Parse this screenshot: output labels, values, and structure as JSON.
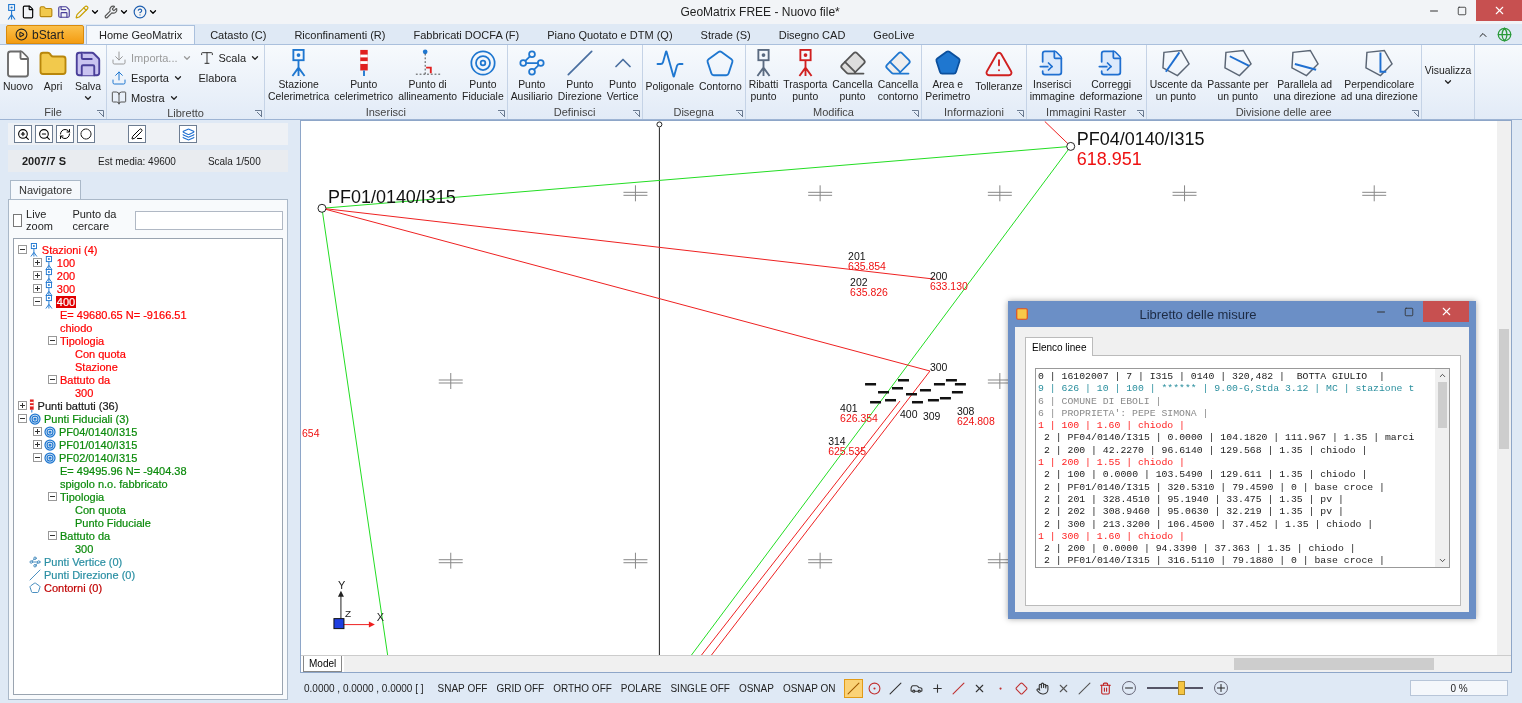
{
  "window": {
    "title": "GeoMatrix FREE - Nuovo file*"
  },
  "start_button": "bStart",
  "tabs": [
    {
      "label": "Home GeoMatrix",
      "selected": true
    },
    {
      "label": "Catasto (C)",
      "selected": false
    },
    {
      "label": "Riconfinamenti (R)",
      "selected": false
    },
    {
      "label": "Fabbricati DOCFA (F)",
      "selected": false
    },
    {
      "label": "Piano Quotato e DTM (Q)",
      "selected": false
    },
    {
      "label": "Strade (S)",
      "selected": false
    },
    {
      "label": "Disegno CAD",
      "selected": false
    },
    {
      "label": "GeoLive",
      "selected": false
    }
  ],
  "ribbon": {
    "groups": [
      {
        "title": "File",
        "buttons": [
          {
            "label": "Nuovo",
            "dropdown": false
          },
          {
            "label": "Apri",
            "dropdown": false
          },
          {
            "label": "Salva",
            "dropdown": true
          }
        ]
      },
      {
        "title": "Libretto",
        "small_buttons": [
          {
            "label": "Importa...",
            "disabled": true,
            "dropdown": true
          },
          {
            "label": "Esporta",
            "disabled": false,
            "dropdown": true
          },
          {
            "label": "Mostra",
            "disabled": false,
            "dropdown": true
          },
          {
            "label": "Scala",
            "disabled": false,
            "dropdown": true
          },
          {
            "label": "Elabora",
            "disabled": false,
            "dropdown": false
          }
        ]
      },
      {
        "title": "Inserisci",
        "buttons": [
          {
            "label": "Stazione\nCelerimetrica",
            "dropdown": false
          },
          {
            "label": "Punto\ncelerimetrico",
            "dropdown": false
          },
          {
            "label": "Punto di\nallineamento",
            "dropdown": false
          },
          {
            "label": "Punto\nFiduciale",
            "dropdown": false
          }
        ]
      },
      {
        "title": "Definisci",
        "buttons": [
          {
            "label": "Punto\nAusiliario",
            "dropdown": false
          },
          {
            "label": "Punto\nDirezione",
            "dropdown": false
          },
          {
            "label": "Punto\nVertice",
            "dropdown": false
          }
        ]
      },
      {
        "title": "Disegna",
        "buttons": [
          {
            "label": "Poligonale",
            "dropdown": false
          },
          {
            "label": "Contorno",
            "dropdown": false
          }
        ]
      },
      {
        "title": "Modifica",
        "buttons": [
          {
            "label": "Ribatti\npunto",
            "dropdown": false
          },
          {
            "label": "Trasporta\npunto",
            "dropdown": false
          },
          {
            "label": "Cancella\npunto",
            "dropdown": false
          },
          {
            "label": "Cancella\ncontorno",
            "dropdown": false
          }
        ]
      },
      {
        "title": "Informazioni",
        "buttons": [
          {
            "label": "Area e\nPerimetro",
            "dropdown": false
          },
          {
            "label": "Tolleranze",
            "dropdown": false
          }
        ]
      },
      {
        "title": "Immagini Raster",
        "buttons": [
          {
            "label": "Inserisci\nimmagine",
            "dropdown": false
          },
          {
            "label": "Correggi\ndeformazione",
            "dropdown": false
          }
        ]
      },
      {
        "title": "Divisione delle aree",
        "buttons": [
          {
            "label": "Uscente da\nun punto",
            "dropdown": false
          },
          {
            "label": "Passante per\nun punto",
            "dropdown": false
          },
          {
            "label": "Parallela ad\nuna direzione",
            "dropdown": false
          },
          {
            "label": "Perpendicolare\nad una direzione",
            "dropdown": false
          }
        ]
      },
      {
        "buttons": [
          {
            "label": "Visualizza",
            "dropdown": true
          }
        ]
      }
    ]
  },
  "left_panel": {
    "info": {
      "code": "2007/7 S",
      "est_media": "Est media: 49600",
      "scale": "Scala 1/500"
    },
    "tab": "Navigatore",
    "live_zoom": {
      "label": "Live zoom",
      "checked": false
    },
    "search": {
      "label": "Punto da cercare"
    },
    "tree": [
      {
        "label": "Stazioni (4)",
        "color": "#ff0000",
        "selected": false,
        "expanded": true,
        "children": [
          {
            "label": "100",
            "selected": false,
            "expanded": false
          },
          {
            "label": "200",
            "selected": false,
            "expanded": false
          },
          {
            "label": "300",
            "selected": false,
            "expanded": false
          },
          {
            "label": "400",
            "selected": true,
            "expanded": true,
            "children": [
              {
                "label": "E= 49680.65 N= -9166.51",
                "selected": false
              },
              {
                "label": "chiodo",
                "selected": false
              },
              {
                "label": "Tipologia",
                "selected": false,
                "expanded": true,
                "children": [
                  {
                    "label": "Con quota",
                    "selected": false
                  },
                  {
                    "label": "Stazione",
                    "selected": false
                  }
                ]
              },
              {
                "label": "Battuto da",
                "selected": false,
                "expanded": true,
                "children": [
                  {
                    "label": "300",
                    "selected": false
                  }
                ]
              }
            ]
          }
        ]
      },
      {
        "label": "Punti battuti (36)",
        "color": "#1a1a1a",
        "selected": false,
        "expanded": false
      },
      {
        "label": "Punti Fiduciali (3)",
        "color": "#0a8a0a",
        "selected": false,
        "expanded": true,
        "children": [
          {
            "label": "PF04/0140/I315",
            "selected": false,
            "expanded": false
          },
          {
            "label": "PF01/0140/I315",
            "selected": false,
            "expanded": false
          },
          {
            "label": "PF02/0140/I315",
            "selected": false,
            "expanded": true,
            "children": [
              {
                "label": "E= 49495.96 N= -9404.38",
                "selected": false
              },
              {
                "label": "spigolo n.o. fabbricato",
                "selected": false
              },
              {
                "label": "Tipologia",
                "selected": false,
                "expanded": true,
                "children": [
                  {
                    "label": "Con quota",
                    "selected": false
                  },
                  {
                    "label": "Punto Fiduciale",
                    "selected": false
                  }
                ]
              },
              {
                "label": "Battuto da",
                "selected": false,
                "expanded": true,
                "children": [
                  {
                    "label": "300",
                    "selected": false
                  }
                ]
              }
            ]
          }
        ]
      },
      {
        "label": "Punti Vertice (0)",
        "color": "#2a8fa3",
        "selected": false
      },
      {
        "label": "Punti Direzione (0)",
        "color": "#2a8fa3",
        "selected": false
      },
      {
        "label": "Contorni (0)",
        "color": "#c00000",
        "selected": false
      }
    ]
  },
  "canvas": {
    "fiducials": [
      {
        "id": "PF01/0140/I315"
      },
      {
        "id": "PF04/0140/I315",
        "elevation": "618.951"
      }
    ],
    "points": [
      {
        "id": "201",
        "elevation": "635.854"
      },
      {
        "id": "202",
        "elevation": "635.826"
      },
      {
        "id": "200",
        "elevation": "633.130"
      },
      {
        "id": "300"
      },
      {
        "id": "401",
        "elevation": "626.354"
      },
      {
        "id": "400"
      },
      {
        "id": "309"
      },
      {
        "id": "308",
        "elevation": "624.808"
      },
      {
        "id": "314",
        "elevation": "625.535"
      }
    ],
    "edge_label": "654",
    "axes": {
      "y": "Y",
      "z": "Z",
      "x": "X"
    },
    "tab": "Model"
  },
  "dialog": {
    "title": "Libretto delle misure",
    "tab": "Elenco linee",
    "lines": [
      {
        "kind": "header",
        "text": "0 | 16102007 | 7 | I315 | 0140 | 320,482 |  BOTTA GIULIO  |"
      },
      {
        "kind": "instrument",
        "text": "9 | 626 | 10 | 100 | ****** | 9.00-G,Stda 3.12 | MC | stazione t"
      },
      {
        "kind": "note",
        "text": "6 | COMUNE DI EBOLI |"
      },
      {
        "kind": "note",
        "text": "6 | PROPRIETA': PEPE SIMONA |"
      },
      {
        "kind": "station",
        "text": "1 | 100 | 1.60 | chiodo |"
      },
      {
        "kind": "reading",
        "text": "2 | PF04/0140/I315 | 0.0000 | 104.1820 | 111.967 | 1.35 | marci"
      },
      {
        "kind": "reading",
        "text": "2 | 200 | 42.2270 | 96.6140 | 129.568 | 1.35 | chiodo |"
      },
      {
        "kind": "station",
        "text": "1 | 200 | 1.55 | chiodo |"
      },
      {
        "kind": "reading",
        "text": "2 | 100 | 0.0000 | 103.5490 | 129.611 | 1.35 | chiodo |"
      },
      {
        "kind": "reading",
        "text": "2 | PF01/0140/I315 | 320.5310 | 79.4590 | 0 | base croce |"
      },
      {
        "kind": "reading",
        "text": "2 | 201 | 328.4510 | 95.1940 | 33.475 | 1.35 | pv |"
      },
      {
        "kind": "reading",
        "text": "2 | 202 | 308.9460 | 95.0630 | 32.219 | 1.35 | pv |"
      },
      {
        "kind": "reading",
        "text": "2 | 300 | 213.3200 | 106.4500 | 37.452 | 1.35 | chiodo |"
      },
      {
        "kind": "station",
        "text": "1 | 300 | 1.60 | chiodo |"
      },
      {
        "kind": "reading",
        "text": "2 | 200 | 0.0000 | 94.3390 | 37.363 | 1.35 | chiodo |"
      },
      {
        "kind": "reading",
        "text": "2 | PF01/0140/I315 | 316.5110 | 79.1880 | 0 | base croce |"
      }
    ]
  },
  "status_bar": {
    "coordinates": "0.0000 , 0.0000 , 0.0000 [ ]",
    "toggles": [
      "SNAP OFF",
      "GRID OFF",
      "ORTHO OFF",
      "POLARE",
      "SINGLE OFF",
      "OSNAP",
      "OSNAP ON"
    ],
    "osnap_tools": [
      {
        "selected": true
      },
      {
        "selected": false
      },
      {
        "selected": false
      },
      {
        "selected": false
      },
      {
        "selected": false
      },
      {
        "selected": false
      },
      {
        "selected": false
      },
      {
        "selected": false
      },
      {
        "selected": false
      },
      {
        "selected": false
      },
      {
        "selected": false
      },
      {
        "selected": false
      },
      {
        "selected": false
      }
    ],
    "zoom": {
      "level": 0.65
    },
    "progress": {
      "level": 0,
      "label": "0 %"
    }
  }
}
